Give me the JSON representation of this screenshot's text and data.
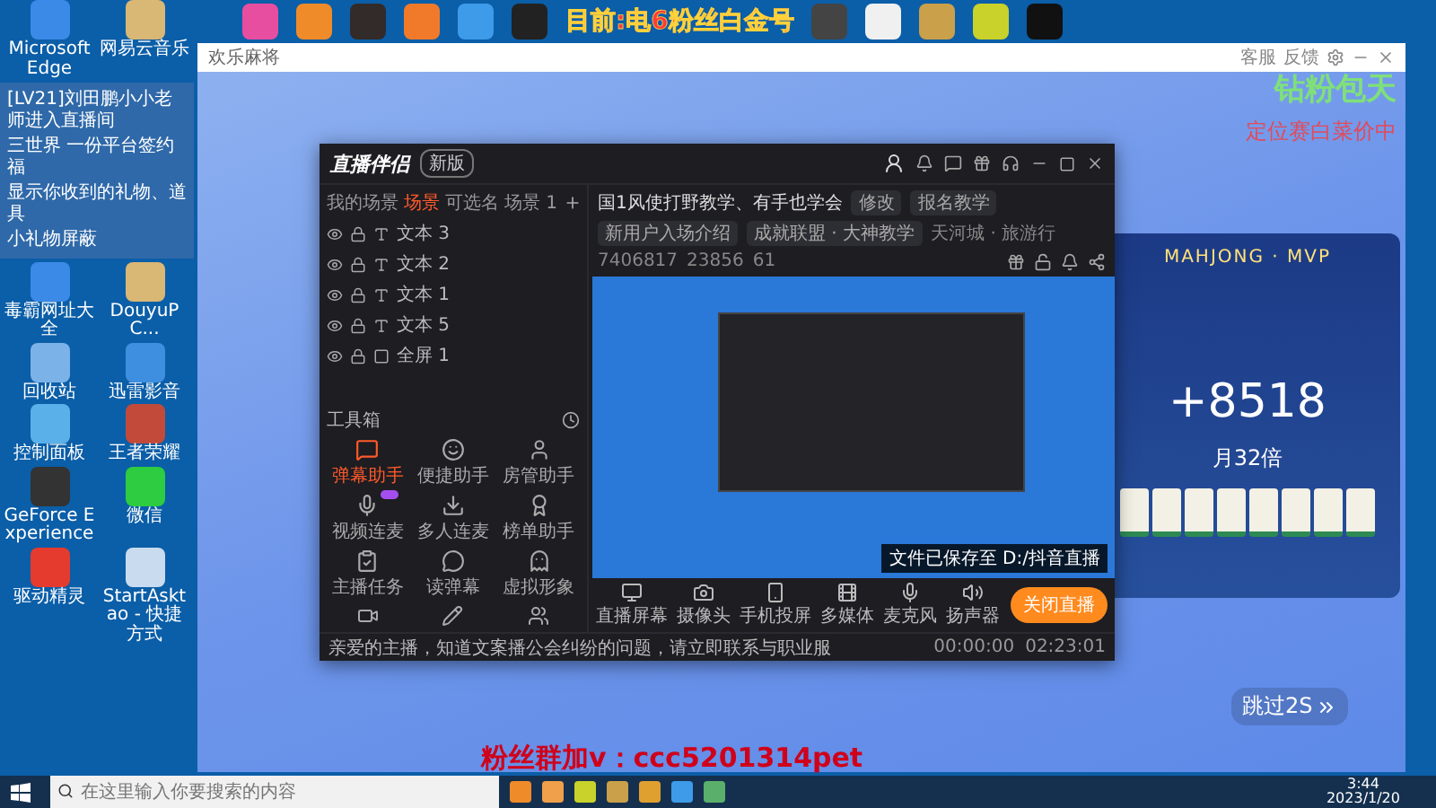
{
  "overlay": {
    "fan_notice": "目前:电6粉丝白金号",
    "promo_green": "钻粉包天",
    "promo_red": "定位赛白菜价中",
    "fan_group": "粉丝群加v：ccc5201314pet"
  },
  "desktop_icons_top": [
    {
      "label": "Microsoft Edge"
    },
    {
      "label": "网易云音乐"
    }
  ],
  "chat_overlay": [
    "[LV21]刘田鹏小小老师进入直播间",
    "三世界 一份平台签约福",
    "显示你收到的礼物、道具",
    "小礼物屏蔽"
  ],
  "desktop_icons": [
    {
      "label": "毒霸网址大全"
    },
    {
      "label": "DouyuPC..."
    },
    {
      "label": "回收站"
    },
    {
      "label": "迅雷影音"
    },
    {
      "label": "控制面板"
    },
    {
      "label": "王者荣耀"
    },
    {
      "label": "GeForce Experience"
    },
    {
      "label": "微信"
    },
    {
      "label": "驱动精灵"
    },
    {
      "label": "StartAsktao - 快捷方式"
    }
  ],
  "game_window": {
    "title": "欢乐麻将",
    "actions": [
      "客服",
      "反馈"
    ],
    "banner": "MAHJONG · MVP",
    "score": "+8518",
    "multiplier": "月32倍",
    "skip": "跳过2S"
  },
  "stream_app": {
    "logo": "直播伴侣",
    "version": "新版",
    "scene_tabs": [
      {
        "label": "我的场景",
        "selected": false
      },
      {
        "label": "场景",
        "selected": true
      },
      {
        "label": "可选名",
        "selected": false
      },
      {
        "label": "场景 1",
        "selected": false
      }
    ],
    "layers": [
      {
        "label": "文本 3",
        "kind": "text"
      },
      {
        "label": "文本 2",
        "kind": "text"
      },
      {
        "label": "文本 1",
        "kind": "text"
      },
      {
        "label": "文本 5",
        "kind": "text"
      },
      {
        "label": "全屏 1",
        "kind": "screen"
      }
    ],
    "toolbox_title": "工具箱",
    "tools": [
      {
        "label": "弹幕助手",
        "selected": true,
        "new": false
      },
      {
        "label": "便捷助手",
        "selected": false,
        "new": false
      },
      {
        "label": "房管助手",
        "selected": false,
        "new": false
      },
      {
        "label": "视频连麦",
        "selected": false,
        "new": true
      },
      {
        "label": "多人连麦",
        "selected": false,
        "new": false
      },
      {
        "label": "榜单助手",
        "selected": false,
        "new": false
      },
      {
        "label": "主播任务",
        "selected": false,
        "new": false
      },
      {
        "label": "读弹幕",
        "selected": false,
        "new": false
      },
      {
        "label": "虚拟形象",
        "selected": false,
        "new": false
      }
    ],
    "room_title": "国1风使打野教学、有手也学会",
    "edit": "修改",
    "tags": [
      "报名教学",
      "新用户入场介绍"
    ],
    "room_info": {
      "guild": "成就联盟 · 大神教学",
      "location": "天河城 · 旅游行",
      "room_id": "7406817",
      "likes": "23856",
      "viewers": "61"
    },
    "bottom_tools": [
      "直播屏幕",
      "摄像头",
      "手机投屏",
      "多媒体",
      "麦克风",
      "扬声器"
    ],
    "save_notice": "文件已保存至 D:/抖音直播",
    "stop_button": "关闭直播",
    "status_notice": "亲爱的主播，知道文案播公会纠纷的问题，请立即联系与职业服",
    "record_time": "00:00:00",
    "live_time": "02:23:01"
  },
  "taskbar": {
    "search_placeholder": "在这里输入你要搜索的内容",
    "time": "3:44",
    "date": "2023/1/20"
  }
}
